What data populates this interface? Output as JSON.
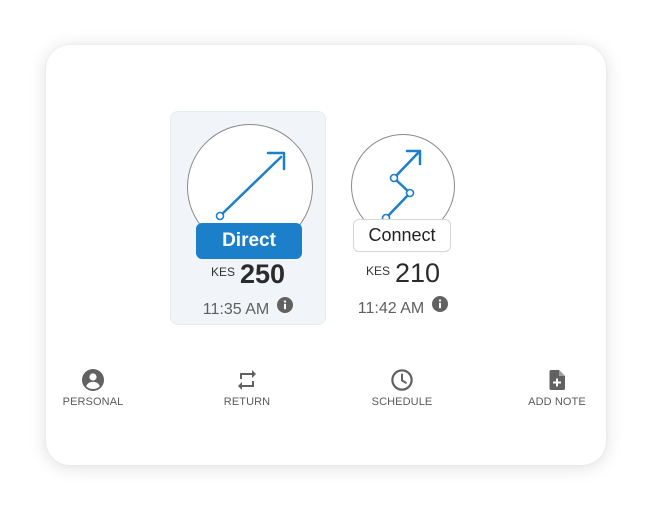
{
  "colors": {
    "accent": "#1b7fc9",
    "selected_background": "#f1f5f9",
    "icon": "#616161"
  },
  "route_options": [
    {
      "label": "Direct",
      "currency": "KES",
      "amount": "250",
      "time": "11:35 AM",
      "selected": true,
      "icon": "direct-route-arrow-icon"
    },
    {
      "label": "Connect",
      "currency": "KES",
      "amount": "210",
      "time": "11:42 AM",
      "selected": false,
      "icon": "connecting-route-arrow-icon"
    }
  ],
  "actions": [
    {
      "label": "PERSONAL",
      "icon": "person-circle-icon"
    },
    {
      "label": "RETURN",
      "icon": "repeat-arrows-icon"
    },
    {
      "label": "SCHEDULE",
      "icon": "clock-icon"
    },
    {
      "label": "ADD NOTE",
      "icon": "add-note-icon"
    }
  ]
}
